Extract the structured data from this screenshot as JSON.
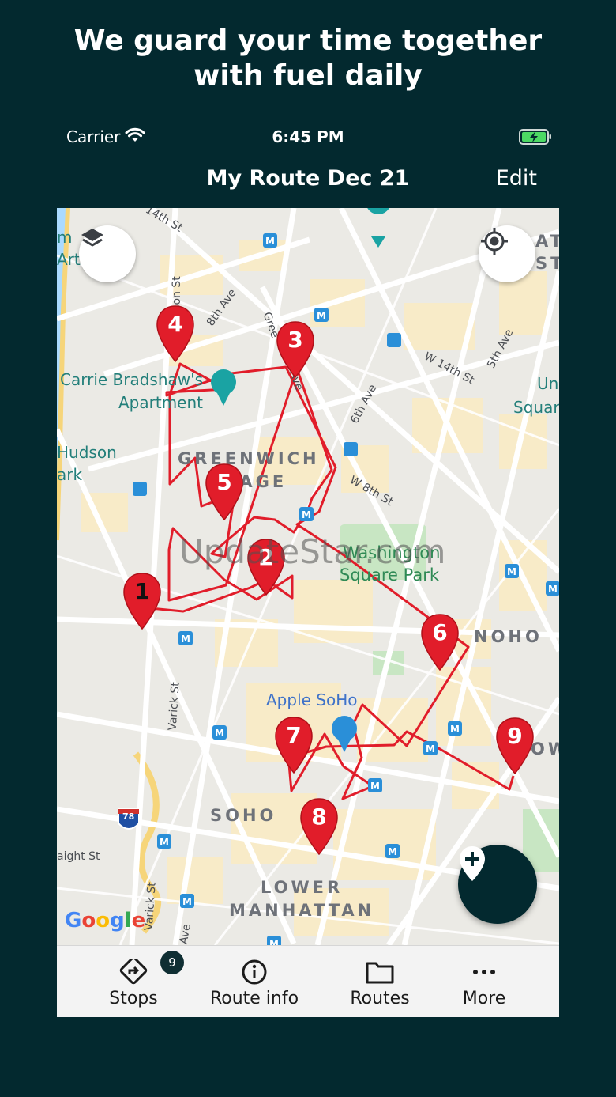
{
  "promo": {
    "line1": "We guard your time together",
    "line2": "with fuel daily"
  },
  "status_bar": {
    "carrier": "Carrier",
    "time": "6:45 PM",
    "wifi_icon": "wifi-icon",
    "battery_icon": "battery-charging-icon"
  },
  "nav": {
    "title": "My Route Dec 21",
    "edit_label": "Edit"
  },
  "map": {
    "watermark": "UpdateStar.com",
    "attribution": [
      "G",
      "o",
      "o",
      "g",
      "l",
      "e"
    ],
    "labels": {
      "carrie_line1": "Carrie Bradshaw's",
      "carrie_line2": "Apartment",
      "hudson_line1": "Hudson",
      "hudson_line2": "ark",
      "greenwich_line1": "GREENWICH",
      "greenwich_line2": "LAGE",
      "washington_line1": "Washington",
      "washington_line2": "Square Park",
      "noho": "NOHO",
      "apple": "Apple SoHo",
      "soho": "SOHO",
      "lower1": "LOWER",
      "lower2": "MANHATTAN",
      "st14": "14th St",
      "ave8": "8th Ave",
      "jackson": "son St",
      "greenwich_ave": "Gree",
      "ave_short": "Ave",
      "w14": "W 14th St",
      "ave5": "5th Ave",
      "ave6": "6th Ave",
      "w8": "W 8th St",
      "varick": "Varick St",
      "varick2": "Varick St",
      "ave_bottom": "Ave",
      "height": "aight St",
      "art1": "m",
      "art2": "Art",
      "union1": "Un",
      "union2": "Squar",
      "at1": "AT",
      "at2": "ST",
      "ow": "OW",
      "i78": "78"
    },
    "stops": [
      "1",
      "2",
      "3",
      "4",
      "5",
      "6",
      "7",
      "8",
      "9"
    ],
    "route_color": "#e11d2a"
  },
  "controls": {
    "layers_icon": "layers-icon",
    "locate_icon": "my-location-icon",
    "add_stop_icon": "add-location-icon"
  },
  "tabs": [
    {
      "label": "Stops",
      "icon": "route-directions-icon",
      "badge": "9"
    },
    {
      "label": "Route info",
      "icon": "info-icon"
    },
    {
      "label": "Routes",
      "icon": "folder-icon"
    },
    {
      "label": "More",
      "icon": "more-dots-icon"
    }
  ]
}
